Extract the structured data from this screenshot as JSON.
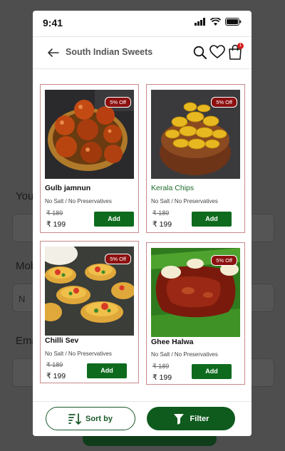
{
  "background": {
    "labels": [
      "You",
      "Mob",
      "Ema"
    ],
    "field_text": "N"
  },
  "status": {
    "time": "9:41"
  },
  "header": {
    "title": "South Indian Sweets",
    "cart_count": "1"
  },
  "products": [
    {
      "name": "Gulb jamnun",
      "subtitle": "No Salt / No Preservatives",
      "old_price": "₹ 189",
      "price": "₹ 199",
      "discount": "5% Off",
      "add_label": "Add",
      "image": "gulab-jamun-bowl"
    },
    {
      "name": "Kerala Chips",
      "subtitle": "No Salt / No Preservatives",
      "old_price": "₹ 189",
      "price": "₹ 199",
      "discount": "5% Off",
      "add_label": "Add",
      "image": "banana-chips-bowl"
    },
    {
      "name": "Chilli Sev",
      "subtitle": "No Salt / No Preservatives",
      "old_price": "₹ 189",
      "price": "₹ 199",
      "discount": "5% Off",
      "add_label": "Add",
      "image": "sev-puri-platter"
    },
    {
      "name": "Ghee Halwa",
      "subtitle": "No Salt / No Preservatives",
      "old_price": "₹ 189",
      "price": "₹ 199",
      "discount": "5% Off",
      "add_label": "Add",
      "image": "halwa-on-leaf"
    }
  ],
  "bottom": {
    "sort_label": "Sort by",
    "filter_label": "Filter"
  },
  "colors": {
    "accent_green": "#0e6b1d",
    "badge_red": "#8c1010",
    "card_border": "#c98a8a"
  }
}
